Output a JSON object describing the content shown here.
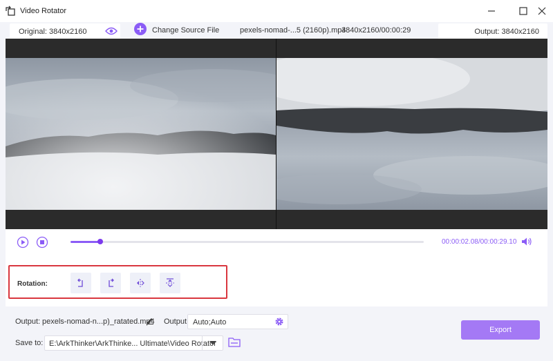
{
  "window": {
    "title": "Video Rotator"
  },
  "infobar": {
    "original_label": "Original: 3840x2160",
    "change_source_label": "Change Source File",
    "file_name": "pexels-nomad-...5 (2160p).mp4",
    "file_info": "3840x2160/00:00:29",
    "output_label": "Output: 3840x2160"
  },
  "playback": {
    "current_time": "00:00:02.08",
    "total_time": "/00:00:29.10",
    "progress": 0.085
  },
  "rotation": {
    "label": "Rotation:"
  },
  "output": {
    "name_label": "Output:",
    "file_name": "pexels-nomad-n...p)_ratated.mp4",
    "format_label": "Output:",
    "format_value": "Auto;Auto"
  },
  "save": {
    "label": "Save to:",
    "path": "E:\\ArkThinker\\ArkThinke... Ultimate\\Video Rotator"
  },
  "export": {
    "label": "Export"
  },
  "colors": {
    "accent": "#8b5cf6",
    "highlight": "#d9363e",
    "export": "#a479f5"
  }
}
